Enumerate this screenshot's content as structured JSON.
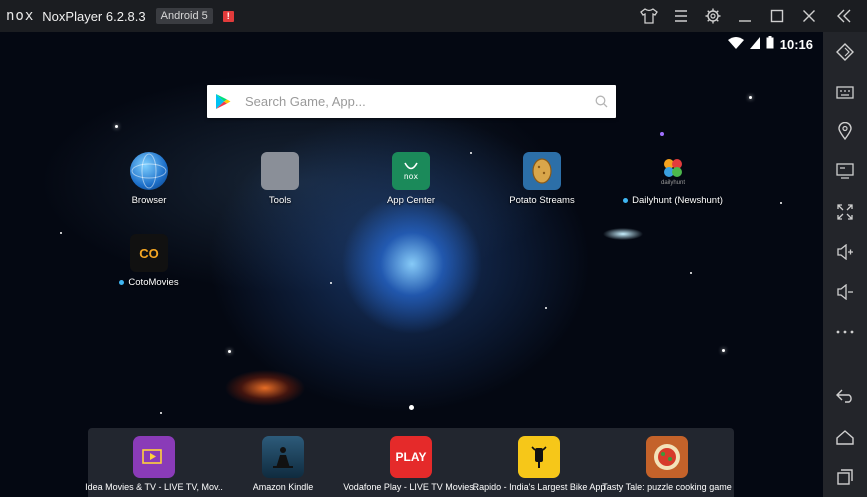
{
  "titlebar": {
    "logo": "nox",
    "title": "NoxPlayer 6.2.8.3",
    "android_badge": "Android 5",
    "alert_badge": "!"
  },
  "statusbar": {
    "time": "10:16"
  },
  "search": {
    "placeholder": "Search Game, App..."
  },
  "desktop_apps": [
    {
      "label": "Browser",
      "icon": "globe-icon"
    },
    {
      "label": "Tools",
      "icon": "tools-folder-icon"
    },
    {
      "label": "App Center",
      "icon": "nox-app-center-icon"
    },
    {
      "label": "Potato Streams",
      "icon": "potato-icon"
    },
    {
      "label": "Dailyhunt (Newshunt)",
      "icon": "dailyhunt-icon",
      "icon_text": "dailyhunt"
    },
    {
      "label": "CotoMovies",
      "icon": "coto-icon",
      "icon_text": "CO"
    }
  ],
  "dock_apps": [
    {
      "label": "Idea Movies & TV - LIVE TV, Mov..",
      "icon": "idea-movies-icon"
    },
    {
      "label": "Amazon Kindle",
      "icon": "kindle-icon"
    },
    {
      "label": "Vodafone Play - LIVE TV Movies..",
      "icon": "vodafone-play-icon",
      "icon_text": "PLAY"
    },
    {
      "label": "Rapido - India's Largest Bike App",
      "icon": "rapido-icon"
    },
    {
      "label": "Tasty Tale: puzzle cooking game",
      "icon": "tasty-tale-icon"
    }
  ],
  "colors": {
    "titlebar_bg": "#1b1d21",
    "sidebar_bg": "#23252a",
    "notification_dot": "#3fb6f2",
    "app_center_green": "#1b8a5a",
    "vodafone_red": "#e52a2a",
    "rapido_yellow": "#f6c719",
    "idea_purple": "#8a3bb8"
  }
}
